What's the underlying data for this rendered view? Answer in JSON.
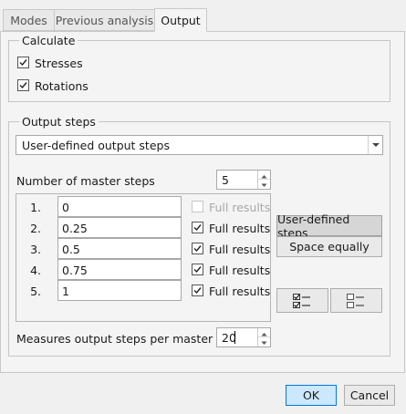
{
  "tabs": [
    {
      "label": "Modes"
    },
    {
      "label": "Previous analysis"
    },
    {
      "label": "Output"
    }
  ],
  "calculate": {
    "legend": "Calculate",
    "stresses": {
      "label": "Stresses",
      "checked": true
    },
    "rotations": {
      "label": "Rotations",
      "checked": true
    }
  },
  "output_steps": {
    "legend": "Output steps",
    "dropdown_value": "User-defined output steps",
    "master_steps_label": "Number of master steps",
    "master_steps_value": "5",
    "steps": [
      {
        "num": "1.",
        "value": "0",
        "full_label": "Full results",
        "checked": false,
        "enabled": false
      },
      {
        "num": "2.",
        "value": "0.25",
        "full_label": "Full results",
        "checked": true,
        "enabled": true
      },
      {
        "num": "3.",
        "value": "0.5",
        "full_label": "Full results",
        "checked": true,
        "enabled": true
      },
      {
        "num": "4.",
        "value": "0.75",
        "full_label": "Full results",
        "checked": true,
        "enabled": true
      },
      {
        "num": "5.",
        "value": "1",
        "full_label": "Full results",
        "checked": true,
        "enabled": true
      }
    ],
    "user_defined_button": "User-defined steps",
    "space_equally_button": "Space equally",
    "measures_label": "Measures output steps per master step",
    "measures_value": "20"
  },
  "footer": {
    "ok": "OK",
    "cancel": "Cancel"
  },
  "colors": {
    "primary_button_bg": "#cce8ff",
    "primary_button_border": "#0078d7"
  }
}
